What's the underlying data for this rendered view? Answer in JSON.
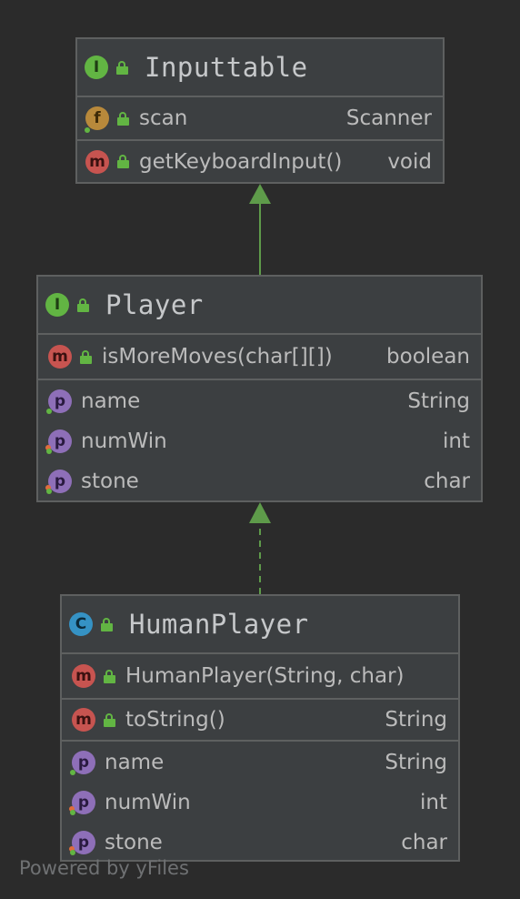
{
  "nodes": {
    "inputtable": {
      "title": "Inputtable",
      "kind_badge": "I",
      "fields": [
        {
          "badge": "f",
          "name": "scan",
          "type": "Scanner"
        }
      ],
      "methods": [
        {
          "badge": "m",
          "name": "getKeyboardInput()",
          "type": "void"
        }
      ]
    },
    "player": {
      "title": "Player",
      "kind_badge": "I",
      "methods": [
        {
          "badge": "m",
          "name": "isMoreMoves(char[][])",
          "type": "boolean"
        }
      ],
      "properties": [
        {
          "badge": "p",
          "name": "name",
          "type": "String"
        },
        {
          "badge": "p",
          "name": "numWin",
          "type": "int"
        },
        {
          "badge": "p",
          "name": "stone",
          "type": "char"
        }
      ]
    },
    "humanplayer": {
      "title": "HumanPlayer",
      "kind_badge": "C",
      "constructors": [
        {
          "badge": "m",
          "name": "HumanPlayer(String, char)",
          "type": ""
        }
      ],
      "methods": [
        {
          "badge": "m",
          "name": "toString()",
          "type": "String"
        }
      ],
      "properties": [
        {
          "badge": "p",
          "name": "name",
          "type": "String"
        },
        {
          "badge": "p",
          "name": "numWin",
          "type": "int"
        },
        {
          "badge": "p",
          "name": "stone",
          "type": "char"
        }
      ]
    }
  },
  "footer": "Powered by yFiles",
  "colors": {
    "background": "#2b2b2b",
    "node_fill": "#3c3f41",
    "node_border": "#5e6060",
    "edge": "#5e9b4a",
    "interface_badge": "#62b543",
    "method_badge": "#c75450",
    "field_badge": "#b8893b",
    "class_badge": "#3592c4",
    "property_badge": "#8e6fb8"
  }
}
